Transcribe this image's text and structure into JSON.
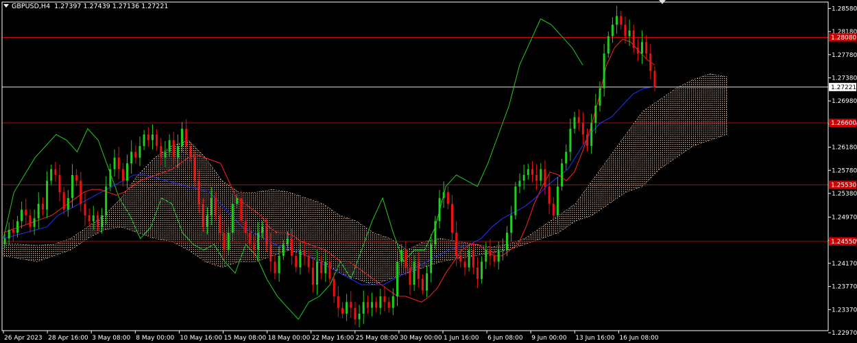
{
  "header": {
    "symbol_tf": "GBPUSD,H4",
    "open": "1.27397",
    "high": "1.27439",
    "low": "1.27136",
    "close": "1.27221"
  },
  "colors": {
    "background": "#000000",
    "axis": "#ffffff",
    "bull_candle": "#22cc22",
    "bear_candle": "#ee1111",
    "tenkan": "#ff2222",
    "kijun": "#2233ff",
    "chikou": "#22cc22",
    "kumo": "#f5c9a8",
    "level_line": "#cc0000",
    "price_line": "#e6e6e6"
  },
  "chart_data": {
    "type": "candlestick",
    "title": "GBPUSD,H4",
    "ylim": [
      1.2297,
      1.2865
    ],
    "y_ticks": [
      "1.28580",
      "1.28180",
      "1.27780",
      "1.27380",
      "1.26980",
      "1.26580",
      "1.26180",
      "1.25780",
      "1.25380",
      "1.24970",
      "1.24570",
      "1.24170",
      "1.23770",
      "1.23370",
      "1.22970"
    ],
    "x_labels": [
      "26 Apr 2023",
      "28 Apr 16:00",
      "3 May 08:00",
      "8 May 00:00",
      "10 May 16:00",
      "15 May 08:00",
      "18 May 00:00",
      "22 May 16:00",
      "25 May 08:00",
      "30 May 00:00",
      "1 Jun 16:00",
      "6 Jun 08:00",
      "9 Jun 00:00",
      "13 Jun 16:00",
      "16 Jun 08:00"
    ],
    "levels": [
      {
        "value": 1.2808,
        "label": "1.28080",
        "color": "#cc0000"
      },
      {
        "value": 1.266,
        "label": "1.26600",
        "color": "#cc0000"
      },
      {
        "value": 1.2553,
        "label": "1.25530",
        "color": "#cc0000"
      },
      {
        "value": 1.2455,
        "label": "1.24550",
        "color": "#cc0000"
      }
    ],
    "current_price": {
      "value": 1.27221,
      "label": "1.27221"
    },
    "candles_close": [
      1.246,
      1.2475,
      1.247,
      1.249,
      1.251,
      1.25,
      1.248,
      1.2495,
      1.252,
      1.251,
      1.256,
      1.258,
      1.257,
      1.254,
      1.251,
      1.253,
      1.257,
      1.256,
      1.252,
      1.25,
      1.249,
      1.25,
      1.248,
      1.25,
      1.255,
      1.258,
      1.26,
      1.258,
      1.256,
      1.259,
      1.261,
      1.26,
      1.262,
      1.264,
      1.263,
      1.264,
      1.262,
      1.26,
      1.261,
      1.263,
      1.26,
      1.262,
      1.265,
      1.262,
      1.26,
      1.256,
      1.252,
      1.248,
      1.25,
      1.253,
      1.25,
      1.247,
      1.244,
      1.247,
      1.252,
      1.253,
      1.249,
      1.247,
      1.245,
      1.244,
      1.247,
      1.248,
      1.245,
      1.242,
      1.24,
      1.243,
      1.245,
      1.246,
      1.243,
      1.241,
      1.244,
      1.243,
      1.241,
      1.238,
      1.242,
      1.24,
      1.242,
      1.239,
      1.236,
      1.234,
      1.233,
      1.235,
      1.234,
      1.232,
      1.233,
      1.235,
      1.234,
      1.235,
      1.234,
      1.236,
      1.235,
      1.234,
      1.236,
      1.242,
      1.244,
      1.241,
      1.238,
      1.242,
      1.239,
      1.237,
      1.24,
      1.245,
      1.249,
      1.253,
      1.254,
      1.252,
      1.247,
      1.243,
      1.242,
      1.241,
      1.244,
      1.241,
      1.239,
      1.242,
      1.244,
      1.243,
      1.242,
      1.244,
      1.244,
      1.247,
      1.25,
      1.255,
      1.256,
      1.257,
      1.258,
      1.257,
      1.256,
      1.258,
      1.255,
      1.252,
      1.25,
      1.255,
      1.259,
      1.261,
      1.265,
      1.267,
      1.266,
      1.264,
      1.262,
      1.266,
      1.269,
      1.272,
      1.278,
      1.281,
      1.283,
      1.2845,
      1.283,
      1.281,
      1.282,
      1.279,
      1.278,
      1.28,
      1.278,
      1.275,
      1.2722
    ],
    "tenkan_sen": [
      1.247,
      1.2475,
      1.248,
      1.2485,
      1.249,
      1.2495,
      1.25,
      1.251,
      1.252,
      1.253,
      1.254,
      1.2545,
      1.2545,
      1.254,
      1.2535,
      1.254,
      1.255,
      1.256,
      1.2565,
      1.257,
      1.2575,
      1.258,
      1.259,
      1.26,
      1.2605,
      1.26,
      1.2595,
      1.259,
      1.256,
      1.253,
      1.252,
      1.251,
      1.25,
      1.248,
      1.247,
      1.247,
      1.2465,
      1.2455,
      1.245,
      1.2445,
      1.244,
      1.243,
      1.242,
      1.242,
      1.241,
      1.24,
      1.239,
      1.238,
      1.237,
      1.236,
      1.236,
      1.2355,
      1.235,
      1.236,
      1.2375,
      1.24,
      1.242,
      1.244,
      1.245,
      1.245,
      1.244,
      1.243,
      1.243,
      1.244,
      1.245,
      1.248,
      1.252,
      1.255,
      1.2575,
      1.257,
      1.256,
      1.2575,
      1.261,
      1.265,
      1.27,
      1.276,
      1.279,
      1.2805,
      1.28,
      1.2785,
      1.277,
      1.276
    ],
    "kijun_sen": [
      1.246,
      1.2465,
      1.247,
      1.2475,
      1.248,
      1.25,
      1.251,
      1.252,
      1.253,
      1.254,
      1.255,
      1.256,
      1.257,
      1.257,
      1.2565,
      1.256,
      1.2555,
      1.255,
      1.2545,
      1.254,
      1.252,
      1.25,
      1.248,
      1.247,
      1.246,
      1.245,
      1.2445,
      1.244,
      1.243,
      1.242,
      1.241,
      1.24,
      1.239,
      1.238,
      1.238,
      1.238,
      1.239,
      1.24,
      1.241,
      1.242,
      1.243,
      1.244,
      1.2445,
      1.245,
      1.246,
      1.248,
      1.2495,
      1.2505,
      1.2515,
      1.253,
      1.255,
      1.2565,
      1.258,
      1.261,
      1.264,
      1.266,
      1.267,
      1.269,
      1.271,
      1.272,
      1.2722
    ],
    "chikou_span": [
      1.246,
      1.254,
      1.257,
      1.26,
      1.262,
      1.264,
      1.263,
      1.261,
      1.265,
      1.263,
      1.258,
      1.253,
      1.25,
      1.246,
      1.248,
      1.253,
      1.252,
      1.247,
      1.245,
      1.244,
      1.245,
      1.242,
      1.24,
      1.245,
      1.243,
      1.239,
      1.236,
      1.234,
      1.232,
      1.235,
      1.236,
      1.238,
      1.242,
      1.239,
      1.244,
      1.249,
      1.253,
      1.247,
      1.242,
      1.244,
      1.244,
      1.248,
      1.255,
      1.257,
      1.256,
      1.255,
      1.259,
      1.264,
      1.269,
      1.276,
      1.28,
      1.284,
      1.283,
      1.281,
      1.279,
      1.276
    ],
    "kumo_upper": [
      1.2452,
      1.245,
      1.2448,
      1.245,
      1.246,
      1.248,
      1.25,
      1.253,
      1.257,
      1.26,
      1.262,
      1.263,
      1.26,
      1.256,
      1.254,
      1.254,
      1.2545,
      1.254,
      1.253,
      1.252,
      1.25,
      1.249,
      1.247,
      1.246,
      1.244,
      1.2455,
      1.246,
      1.2455,
      1.245,
      1.2445,
      1.245,
      1.246,
      1.248,
      1.25,
      1.252,
      1.256,
      1.26,
      1.264,
      1.268,
      1.27,
      1.272,
      1.2735,
      1.2745,
      1.274
    ],
    "kumo_lower": [
      1.243,
      1.2425,
      1.242,
      1.243,
      1.244,
      1.246,
      1.2475,
      1.248,
      1.247,
      1.246,
      1.2455,
      1.244,
      1.242,
      1.241,
      1.242,
      1.242,
      1.243,
      1.244,
      1.243,
      1.242,
      1.24,
      1.239,
      1.238,
      1.239,
      1.24,
      1.241,
      1.242,
      1.2425,
      1.243,
      1.2435,
      1.244,
      1.245,
      1.246,
      1.247,
      1.249,
      1.25,
      1.252,
      1.254,
      1.255,
      1.258,
      1.26,
      1.262,
      1.263,
      1.264
    ]
  }
}
